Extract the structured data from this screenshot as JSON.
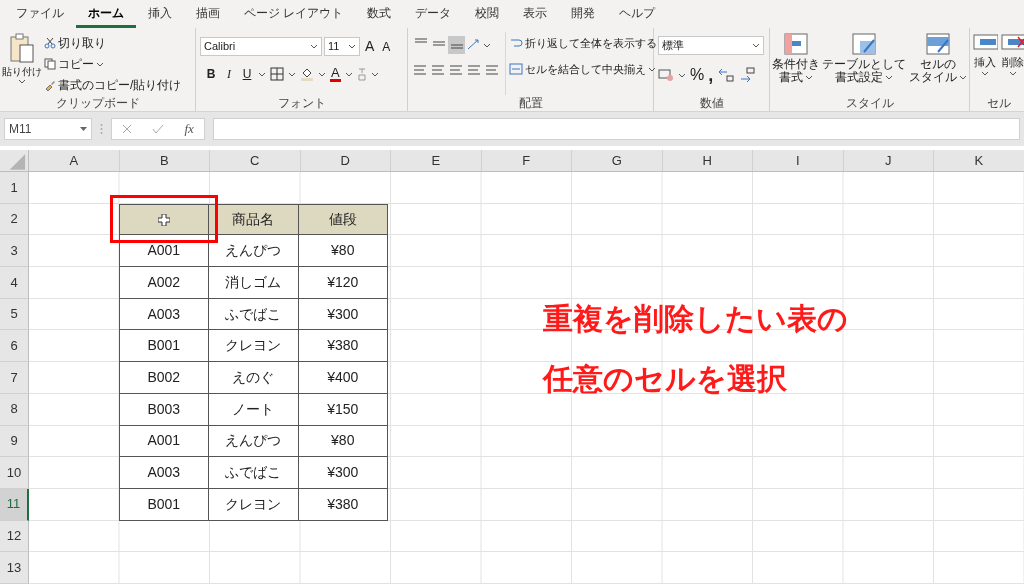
{
  "menu_tabs": [
    {
      "label": "ファイル",
      "selected": false
    },
    {
      "label": "ホーム",
      "selected": true
    },
    {
      "label": "挿入",
      "selected": false
    },
    {
      "label": "描画",
      "selected": false
    },
    {
      "label": "ページ レイアウト",
      "selected": false
    },
    {
      "label": "数式",
      "selected": false
    },
    {
      "label": "データ",
      "selected": false
    },
    {
      "label": "校閲",
      "selected": false
    },
    {
      "label": "表示",
      "selected": false
    },
    {
      "label": "開発",
      "selected": false
    },
    {
      "label": "ヘルプ",
      "selected": false
    }
  ],
  "ribbon": {
    "clipboard": {
      "paste": "貼り付け",
      "cut": "切り取り",
      "copy": "コピー",
      "format_painter": "書式のコピー/貼り付け",
      "group_label": "クリップボード"
    },
    "font": {
      "font_name": "Calibri",
      "font_size": "11",
      "grow_label": "A",
      "shrink_label": "A",
      "styles": [
        "B",
        "I",
        "U"
      ],
      "font_color_label": "A",
      "group_label": "フォント"
    },
    "alignment": {
      "vertical": [
        {
          "selected": false
        },
        {
          "selected": false
        },
        {
          "selected": true
        }
      ],
      "wrap_text": "折り返して全体を表示する",
      "merge_center": "セルを結合して中央揃え",
      "group_label": "配置"
    },
    "number": {
      "format": "標準",
      "percent": "%",
      "comma": ",",
      "group_label": "数値"
    },
    "styles": {
      "buttons": [
        {
          "line1": "条件付き",
          "line2": "書式"
        },
        {
          "line1": "テーブルとして",
          "line2": "書式設定"
        },
        {
          "line1": "セルの",
          "line2": "スタイル"
        }
      ],
      "group_label": "スタイル"
    },
    "cells": {
      "buttons": [
        "挿入",
        "削除"
      ],
      "group_label": "セル"
    }
  },
  "formula_bar": {
    "name_box": "M11",
    "fx": "fx"
  },
  "sheet": {
    "columns": [
      "A",
      "B",
      "C",
      "D",
      "E",
      "F",
      "G",
      "H",
      "I",
      "J",
      "K"
    ],
    "rows": [
      {
        "label": "1",
        "selected": false
      },
      {
        "label": "2",
        "selected": false
      },
      {
        "label": "3",
        "selected": false
      },
      {
        "label": "4",
        "selected": false
      },
      {
        "label": "5",
        "selected": false
      },
      {
        "label": "6",
        "selected": false
      },
      {
        "label": "7",
        "selected": false
      },
      {
        "label": "8",
        "selected": false
      },
      {
        "label": "9",
        "selected": false
      },
      {
        "label": "10",
        "selected": false
      },
      {
        "label": "11",
        "selected": true
      },
      {
        "label": "12",
        "selected": false
      },
      {
        "label": "13",
        "selected": false
      }
    ],
    "table_header": [
      "商品名",
      "値段"
    ],
    "table_rows": [
      [
        "A001",
        "えんぴつ",
        "¥80"
      ],
      [
        "A002",
        "消しゴム",
        "¥120"
      ],
      [
        "A003",
        "ふでばこ",
        "¥300"
      ],
      [
        "B001",
        "クレヨン",
        "¥380"
      ],
      [
        "B002",
        "えのぐ",
        "¥400"
      ],
      [
        "B003",
        "ノート",
        "¥150"
      ],
      [
        "A001",
        "えんぴつ",
        "¥80"
      ],
      [
        "A003",
        "ふでばこ",
        "¥300"
      ],
      [
        "B001",
        "クレヨン",
        "¥380"
      ]
    ]
  },
  "annotation": [
    "重複を削除したい表の",
    "任意のセルを選択"
  ]
}
